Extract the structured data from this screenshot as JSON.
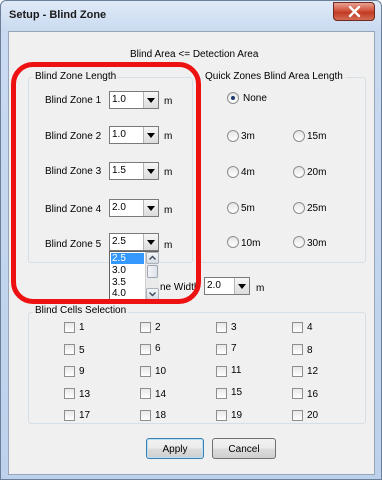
{
  "window": {
    "title": "Setup - Blind Zone",
    "colors": {
      "accent_red": "#ee1111",
      "selection": "#3399ff",
      "close_button": "#c23a22"
    }
  },
  "header_text": "Blind Area <= Detection Area",
  "blind_zone_length": {
    "group_title": "Blind Zone Length",
    "unit": "m",
    "zones": [
      {
        "label": "Blind Zone 1",
        "value": "1.0"
      },
      {
        "label": "Blind Zone 2",
        "value": "1.0"
      },
      {
        "label": "Blind Zone 3",
        "value": "1.5"
      },
      {
        "label": "Blind Zone 4",
        "value": "2.0"
      },
      {
        "label": "Blind Zone 5",
        "value": "2.5"
      }
    ],
    "dropdown_options": [
      "2.5",
      "3.0",
      "3.5",
      "4.0"
    ],
    "dropdown_selected": "2.5"
  },
  "quick_zones": {
    "group_title": "Quick Zones Blind Area Length",
    "options": [
      "None",
      "3m",
      "15m",
      "4m",
      "20m",
      "5m",
      "25m",
      "10m",
      "30m"
    ],
    "selected": "None"
  },
  "lane_width": {
    "label_visible": "ne Width",
    "value": "2.0",
    "unit": "m"
  },
  "blind_cells": {
    "group_title_visible": "Blind Cells Selection",
    "cells": [
      "1",
      "2",
      "3",
      "4",
      "5",
      "6",
      "7",
      "8",
      "9",
      "10",
      "11",
      "12",
      "13",
      "14",
      "15",
      "16",
      "17",
      "18",
      "19",
      "20"
    ]
  },
  "buttons": {
    "apply": "Apply",
    "cancel": "Cancel"
  }
}
